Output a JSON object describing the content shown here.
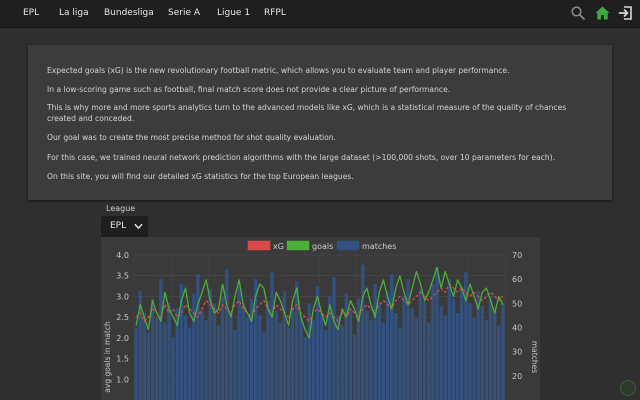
{
  "nav": {
    "links": [
      "EPL",
      "La liga",
      "Bundesliga",
      "Serie A",
      "Ligue 1",
      "RFPL"
    ],
    "icons": [
      "search-icon",
      "home-icon",
      "login-icon"
    ],
    "accent": "#3fa83f"
  },
  "intro": {
    "paragraphs": [
      "Expected goals (xG) is the new revolutionary football metric, which allows you to evaluate team and player performance.",
      "In a low-scoring game such as football, final match score does not provide a clear picture of performance.",
      "This is why more and more sports analytics turn to the advanced models like xG, which is a statistical measure of the quality of chances created and conceded.",
      "Our goal was to create the most precise method for shot quality evaluation.",
      "For this case, we trained neural network prediction algorithms with the large dataset (>100,000 shots, over 10 parameters for each).",
      "On this site, you will find our detailed xG statistics for the top European leagues."
    ]
  },
  "league_select": {
    "label": "League",
    "value": "EPL"
  },
  "chart_data": {
    "type": "bar",
    "legend_position": "top",
    "series": [
      {
        "name": "xG",
        "type": "line",
        "style": "dashed",
        "color": "#d94a4a",
        "axis": "left",
        "values": [
          2.5,
          2.6,
          2.4,
          2.5,
          2.7,
          2.6,
          2.5,
          2.8,
          2.6,
          2.7,
          2.5,
          2.6,
          2.8,
          2.7,
          2.6,
          2.5,
          2.7,
          2.9,
          2.8,
          2.7,
          2.6,
          2.8,
          2.7,
          2.6,
          2.8,
          2.9,
          2.7,
          2.6,
          2.5,
          2.7,
          2.8,
          2.9,
          2.7,
          2.6,
          2.8,
          2.7,
          2.6,
          2.5,
          2.7,
          2.8,
          2.6,
          2.5,
          2.4,
          2.6,
          2.7,
          2.6,
          2.5,
          2.6,
          2.5,
          2.4,
          2.6,
          2.5,
          2.7,
          2.6,
          2.5,
          2.7,
          2.8,
          2.7,
          2.6,
          2.8,
          2.9,
          2.8,
          2.7,
          2.9,
          3.0,
          2.9,
          2.8,
          2.9,
          3.0,
          3.1,
          3.0,
          2.9,
          3.0,
          3.1,
          3.2,
          3.1,
          3.3,
          3.2,
          3.1,
          3.2,
          3.1,
          3.0,
          3.1,
          3.0,
          2.9,
          3.0,
          3.1,
          3.0,
          2.9,
          3.0
        ]
      },
      {
        "name": "goals",
        "type": "line",
        "color": "#4caf3a",
        "axis": "left",
        "values": [
          2.3,
          2.8,
          2.5,
          2.2,
          2.9,
          2.6,
          2.4,
          3.1,
          2.7,
          2.5,
          2.3,
          2.9,
          3.2,
          2.6,
          2.4,
          2.8,
          3.1,
          3.4,
          2.9,
          2.6,
          2.7,
          3.3,
          2.8,
          2.5,
          3.0,
          3.4,
          2.8,
          2.6,
          2.4,
          3.0,
          3.3,
          3.2,
          2.7,
          2.5,
          3.1,
          2.9,
          2.6,
          2.3,
          2.9,
          3.2,
          2.5,
          2.2,
          2.0,
          2.7,
          3.0,
          2.6,
          2.3,
          2.8,
          2.4,
          2.2,
          2.7,
          2.5,
          2.9,
          2.7,
          2.4,
          3.0,
          3.2,
          2.8,
          2.5,
          3.1,
          3.4,
          3.0,
          2.7,
          3.2,
          3.5,
          3.1,
          2.8,
          3.2,
          3.6,
          3.3,
          2.9,
          3.1,
          3.4,
          3.7,
          3.2,
          3.6,
          3.3,
          3.0,
          3.4,
          3.2,
          2.9,
          3.3,
          3.0,
          2.7,
          3.1,
          3.2,
          2.9,
          2.6,
          3.0,
          2.8
        ]
      },
      {
        "name": "matches",
        "type": "bar",
        "color": "#33517e",
        "axis": "right",
        "values": [
          40,
          55,
          46,
          38,
          52,
          44,
          60,
          42,
          50,
          36,
          48,
          58,
          45,
          40,
          54,
          62,
          47,
          43,
          56,
          50,
          41,
          53,
          64,
          46,
          39,
          57,
          49,
          44,
          52,
          60,
          45,
          38,
          51,
          63,
          47,
          42,
          55,
          40,
          48,
          59,
          44,
          36,
          50,
          43,
          57,
          46,
          39,
          53,
          61,
          45,
          41,
          54,
          48,
          37,
          52,
          66,
          47,
          43,
          58,
          50,
          42,
          55,
          62,
          46,
          40,
          53,
          60,
          48,
          44,
          56,
          51,
          42,
          58,
          65,
          49,
          45,
          60,
          52,
          46,
          57,
          63,
          50,
          44,
          55,
          49,
          43,
          53,
          47,
          41,
          50
        ]
      }
    ],
    "y_left": {
      "label": "avg goals in match",
      "ticks": [
        1.0,
        1.5,
        2.0,
        2.5,
        3.0,
        3.5,
        4.0
      ],
      "range": [
        0.5,
        4.0
      ]
    },
    "y_right": {
      "label": "matches",
      "ticks": [
        20,
        30,
        40,
        50,
        60,
        70
      ],
      "range": [
        10,
        70
      ]
    }
  }
}
